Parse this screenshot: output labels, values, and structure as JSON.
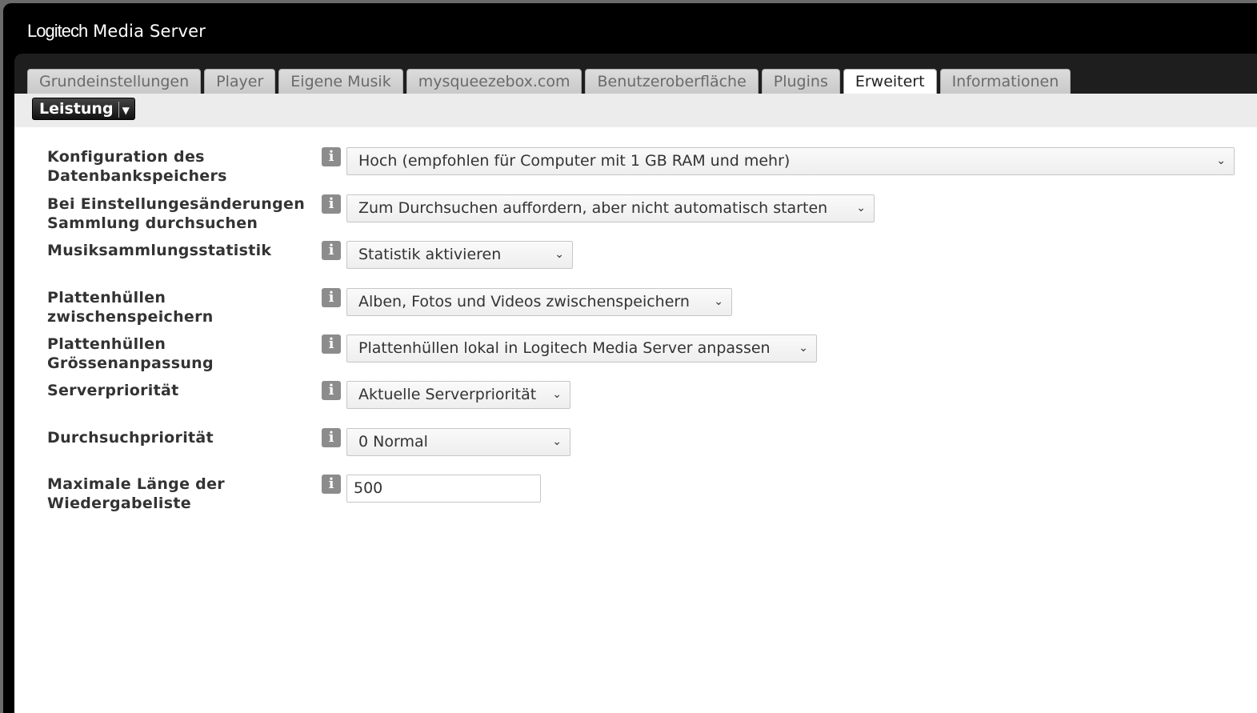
{
  "app": {
    "logo_text": "Logitech",
    "title_text": "Media Server"
  },
  "tabs": [
    {
      "label": "Grundeinstellungen",
      "active": false
    },
    {
      "label": "Player",
      "active": false
    },
    {
      "label": "Eigene Musik",
      "active": false
    },
    {
      "label": "mysqueezebox.com",
      "active": false
    },
    {
      "label": "Benutzeroberfläche",
      "active": false
    },
    {
      "label": "Plugins",
      "active": false
    },
    {
      "label": "Erweitert",
      "active": true
    },
    {
      "label": "Informationen",
      "active": false
    }
  ],
  "subpage": {
    "selected": "Leistung"
  },
  "settings": [
    {
      "label_line1": "Konfiguration des",
      "label_line2": "Datenbankspeichers",
      "info": "i",
      "value": "Hoch (empfohlen für Computer mit 1 GB RAM und mehr)"
    },
    {
      "label_line1": "Bei Einstellungesänderungen",
      "label_line2": "Sammlung durchsuchen",
      "info": "i",
      "value": "Zum Durchsuchen auffordern, aber nicht automatisch starten"
    },
    {
      "label_line1": "Musiksammlungsstatistik",
      "label_line2": "",
      "info": "i",
      "value": "Statistik aktivieren"
    },
    {
      "label_line1": "Plattenhüllen",
      "label_line2": "zwischenspeichern",
      "info": "i",
      "value": "Alben, Fotos und Videos zwischenspeichern"
    },
    {
      "label_line1": "Plattenhüllen",
      "label_line2": "Grössenanpassung",
      "info": "i",
      "value": "Plattenhüllen lokal in Logitech Media Server anpassen"
    },
    {
      "label_line1": "Serverpriorität",
      "label_line2": "",
      "info": "i",
      "value": "Aktuelle Serverpriorität"
    },
    {
      "label_line1": "Durchsuchpriorität",
      "label_line2": "",
      "info": "i",
      "value": "0 Normal"
    },
    {
      "label_line1": "Maximale Länge der",
      "label_line2": "Wiedergabeliste",
      "info": "i",
      "value": "500"
    }
  ],
  "icons": {
    "chevron": "chevron-down-icon",
    "info": "info-icon"
  }
}
